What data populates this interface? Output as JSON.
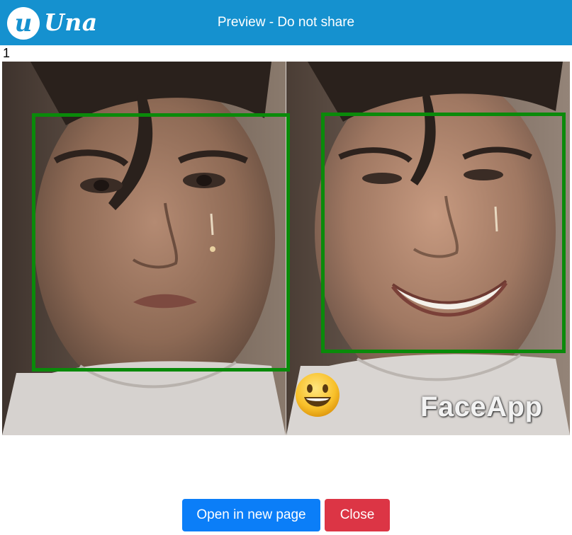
{
  "header": {
    "logo_letter": "u",
    "logo_text": "Una",
    "title": "Preview - Do not share",
    "background_color": "#1591cf"
  },
  "preview": {
    "index": "1",
    "left_panel": {
      "description_icon": "face-photo",
      "face_box_color": "#0a8a0a"
    },
    "right_panel": {
      "description_icon": "face-photo-smiling",
      "face_box_color": "#0a8a0a",
      "emoji": "grinning-face-emoji",
      "watermark": "FaceApp"
    }
  },
  "actions": {
    "open_label": "Open in new page",
    "open_color": "#0b7ef8",
    "close_label": "Close",
    "close_color": "#dc3545"
  }
}
